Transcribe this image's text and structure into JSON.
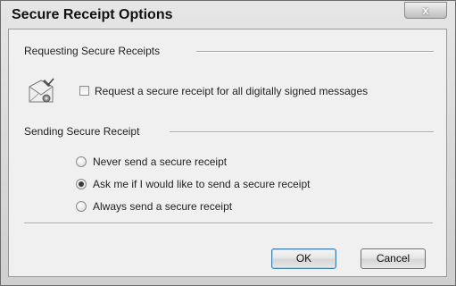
{
  "window": {
    "title": "Secure Receipt Options",
    "close_glyph": "x"
  },
  "requesting": {
    "heading": "Requesting Secure Receipts",
    "icon": "signed-envelope-icon",
    "checkbox_label": "Request a secure receipt for all digitally signed messages",
    "checked": false
  },
  "sending": {
    "heading": "Sending Secure Receipt",
    "options": [
      {
        "label": "Never send a secure receipt",
        "selected": false
      },
      {
        "label": "Ask me if I would like to send a secure receipt",
        "selected": true
      },
      {
        "label": "Always send a secure receipt",
        "selected": false
      }
    ]
  },
  "buttons": {
    "ok": "OK",
    "cancel": "Cancel"
  }
}
